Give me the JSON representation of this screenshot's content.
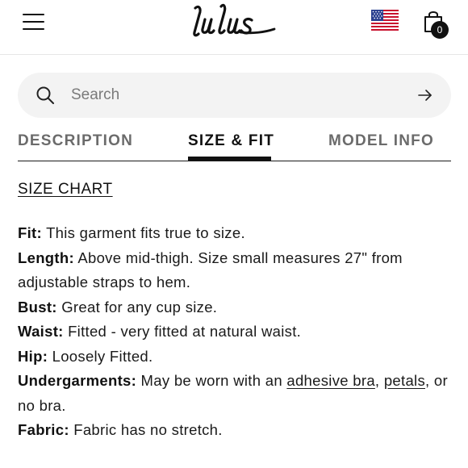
{
  "header": {
    "logo_text": "Lulus",
    "cart_count": "0",
    "menu_icon": "hamburger-menu-icon",
    "flag_icon": "us-flag-icon",
    "cart_icon": "shopping-bag-icon"
  },
  "search": {
    "placeholder": "Search",
    "value": "",
    "icon": "search-icon",
    "submit_icon": "arrow-right-icon"
  },
  "tabs": [
    {
      "label": "DESCRIPTION",
      "active": false
    },
    {
      "label": "SIZE & FIT",
      "active": true
    },
    {
      "label": "MODEL INFO",
      "active": false
    }
  ],
  "size_chart_link": "SIZE CHART",
  "details": {
    "fit": {
      "label": "Fit:",
      "text": "This garment fits true to size."
    },
    "length": {
      "label": "Length:",
      "text": "Above mid-thigh. Size small measures 27\" from adjustable straps to hem."
    },
    "bust": {
      "label": "Bust:",
      "text": "Great for any cup size."
    },
    "waist": {
      "label": "Waist:",
      "text": "Fitted - very fitted at natural waist."
    },
    "hip": {
      "label": "Hip:",
      "text": "Loosely Fitted."
    },
    "undergarments": {
      "label": "Undergarments:",
      "text_before": "May be worn with an",
      "link1": "adhesive bra",
      "sep": ",",
      "link2": "petals",
      "text_after": ", or no bra."
    },
    "fabric": {
      "label": "Fabric:",
      "text": "Fabric has no stretch."
    }
  },
  "colors": {
    "accent": "#111111",
    "inactive_tab": "#6b6b6b",
    "search_bg": "#f3f3f3"
  }
}
